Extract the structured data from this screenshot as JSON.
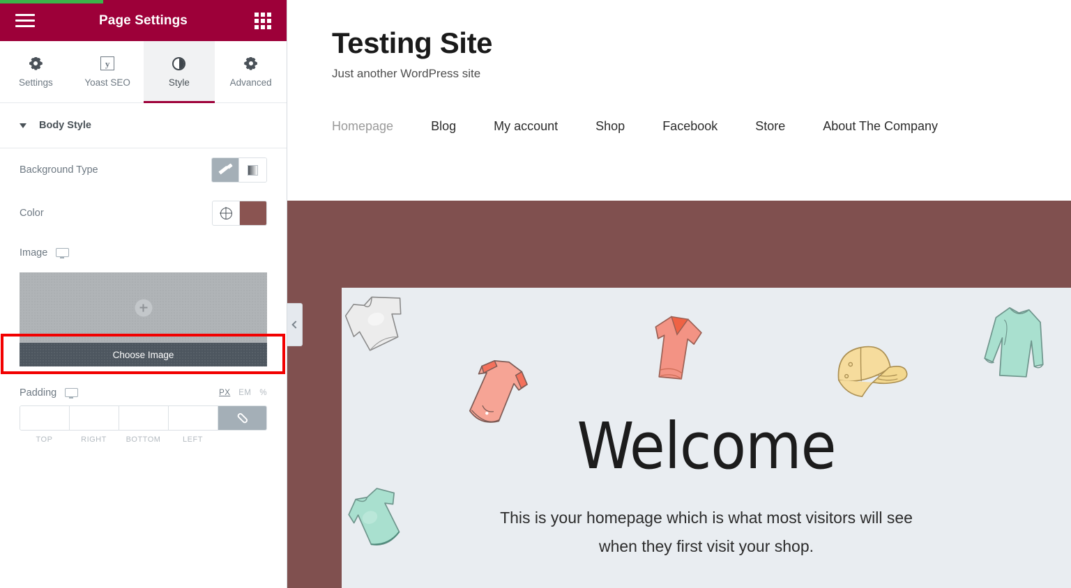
{
  "panel": {
    "progress_percent": 36,
    "header": {
      "title": "Page Settings",
      "menu_icon": "hamburger-icon",
      "apps_icon": "grid-apps-icon"
    },
    "tabs": [
      {
        "label": "Settings",
        "icon": "gear-icon",
        "active": false
      },
      {
        "label": "Yoast SEO",
        "icon": "yoast-logo-icon",
        "active": false
      },
      {
        "label": "Style",
        "icon": "contrast-icon",
        "active": true
      },
      {
        "label": "Advanced",
        "icon": "gear-icon",
        "active": false
      }
    ],
    "section": {
      "title": "Body Style",
      "expanded": true,
      "caret_icon": "caret-down-icon"
    },
    "controls": {
      "background_type": {
        "label": "Background Type",
        "options": [
          {
            "name": "classic",
            "icon": "brush-icon",
            "selected": true
          },
          {
            "name": "gradient",
            "icon": "gradient-icon",
            "selected": false
          }
        ]
      },
      "color": {
        "label": "Color",
        "globe_icon": "globe-icon",
        "value": "#8a5451"
      },
      "image": {
        "label": "Image",
        "responsive_icon": "desktop-monitor-icon",
        "dropzone_icon": "plus-circle-icon",
        "button_label": "Choose Image",
        "highlighted": true,
        "highlight_color": "#f20000"
      },
      "padding": {
        "label": "Padding",
        "responsive_icon": "desktop-monitor-icon",
        "units": [
          {
            "label": "PX",
            "selected": true
          },
          {
            "label": "EM",
            "selected": false
          },
          {
            "label": "%",
            "selected": false
          }
        ],
        "fields": [
          {
            "label": "TOP",
            "value": "",
            "placeholder": ""
          },
          {
            "label": "RIGHT",
            "value": "",
            "placeholder": ""
          },
          {
            "label": "BOTTOM",
            "value": "",
            "placeholder": ""
          },
          {
            "label": "LEFT",
            "value": "",
            "placeholder": ""
          }
        ],
        "link_icon": "link-chain-icon",
        "linked": true
      }
    }
  },
  "preview": {
    "collapse_handle_icon": "chevron-left-icon",
    "site": {
      "title": "Testing Site",
      "tagline": "Just another WordPress site",
      "nav": [
        {
          "label": "Homepage",
          "current": true
        },
        {
          "label": "Blog",
          "current": false
        },
        {
          "label": "My account",
          "current": false
        },
        {
          "label": "Shop",
          "current": false
        },
        {
          "label": "Facebook",
          "current": false
        },
        {
          "label": "Store",
          "current": false
        },
        {
          "label": "About The Company",
          "current": false
        }
      ],
      "body_background": "#80504f",
      "hero": {
        "background": "#e9edf1",
        "title": "Welcome",
        "subtitle_line1": "This is your homepage which is what most visitors will see",
        "subtitle_line2": "when they first visit your shop.",
        "illustrations": [
          {
            "name": "white-shirt-sketch",
            "color": "#e6e6e6"
          },
          {
            "name": "coral-romper-sketch",
            "color": "#f4a090"
          },
          {
            "name": "coral-tshirt-sketch",
            "color": "#f09080"
          },
          {
            "name": "yellow-cap-sketch",
            "color": "#f5dc9a"
          },
          {
            "name": "mint-longsleeve-sketch",
            "color": "#a8dfcf"
          },
          {
            "name": "mint-bodysuit-sketch",
            "color": "#a8dfcf"
          }
        ]
      }
    }
  }
}
